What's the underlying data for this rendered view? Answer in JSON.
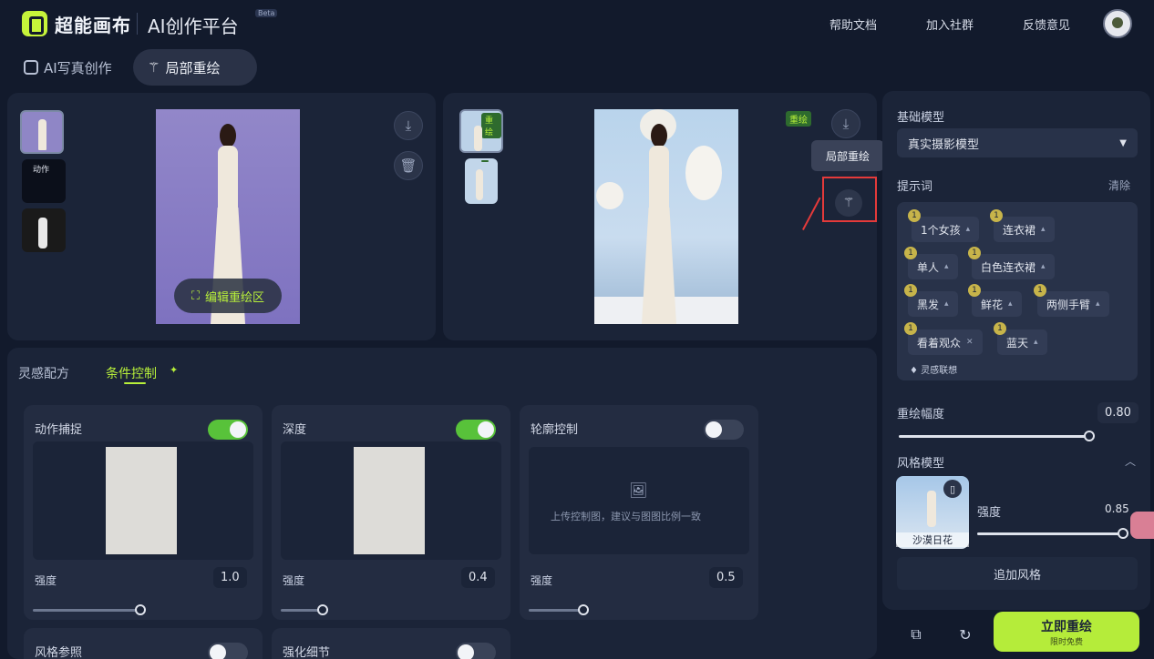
{
  "header": {
    "brand": "超能画布",
    "subtitle": "AI创作平台",
    "version": "Beta",
    "links": [
      "帮助文档",
      "加入社群",
      "反馈意见"
    ]
  },
  "tabs": [
    {
      "label": "AI写真创作",
      "icon": "portrait-icon"
    },
    {
      "label": "局部重绘",
      "icon": "wand-icon"
    }
  ],
  "source": {
    "thumb_labels": [
      "动作"
    ],
    "edit_label": "编辑重绘区"
  },
  "result": {
    "badge": "重绘",
    "thumb_badge": "重绘",
    "tooltip": "局部重绘"
  },
  "subtabs": [
    "灵感配方",
    "条件控制"
  ],
  "cards": [
    {
      "title": "动作捕捉",
      "on": true,
      "strength_label": "强度",
      "value": "1.0",
      "level": 0.88
    },
    {
      "title": "深度",
      "on": true,
      "strength_label": "强度",
      "value": "0.4",
      "level": 0.35
    },
    {
      "title": "轮廓控制",
      "on": false,
      "strength_label": "强度",
      "value": "0.5",
      "level": 0.44,
      "upload_text": "上传控制图，建议与图图比例一致"
    },
    {
      "title": "风格参照",
      "on": false
    },
    {
      "title": "强化细节",
      "on": false
    }
  ],
  "right": {
    "base_model_label": "基础模型",
    "base_model": "真实摄影模型",
    "prompt_label": "提示词",
    "clear": "清除",
    "chips": [
      {
        "text": "1个女孩",
        "n": "1"
      },
      {
        "text": "连衣裙",
        "n": "1"
      },
      {
        "text": "单人",
        "n": "1"
      },
      {
        "text": "白色连衣裙",
        "n": "1"
      },
      {
        "text": "黑发",
        "n": "1"
      },
      {
        "text": "鲜花",
        "n": "1"
      },
      {
        "text": "两侧手臂",
        "n": "1"
      },
      {
        "text": "看着观众",
        "n": "1"
      },
      {
        "text": "蓝天",
        "n": "1"
      }
    ],
    "inspire": "灵感联想",
    "redraw_label": "重绘幅度",
    "redraw_value": "0.80",
    "redraw_level": 0.8,
    "style_model_label": "风格模型",
    "style_strength_label": "强度",
    "style_value": "0.85",
    "style_level": 0.98,
    "style_name": "沙漠日花",
    "add_style": "追加风格",
    "go_label": "立即重绘",
    "go_sub": "限时免费"
  }
}
